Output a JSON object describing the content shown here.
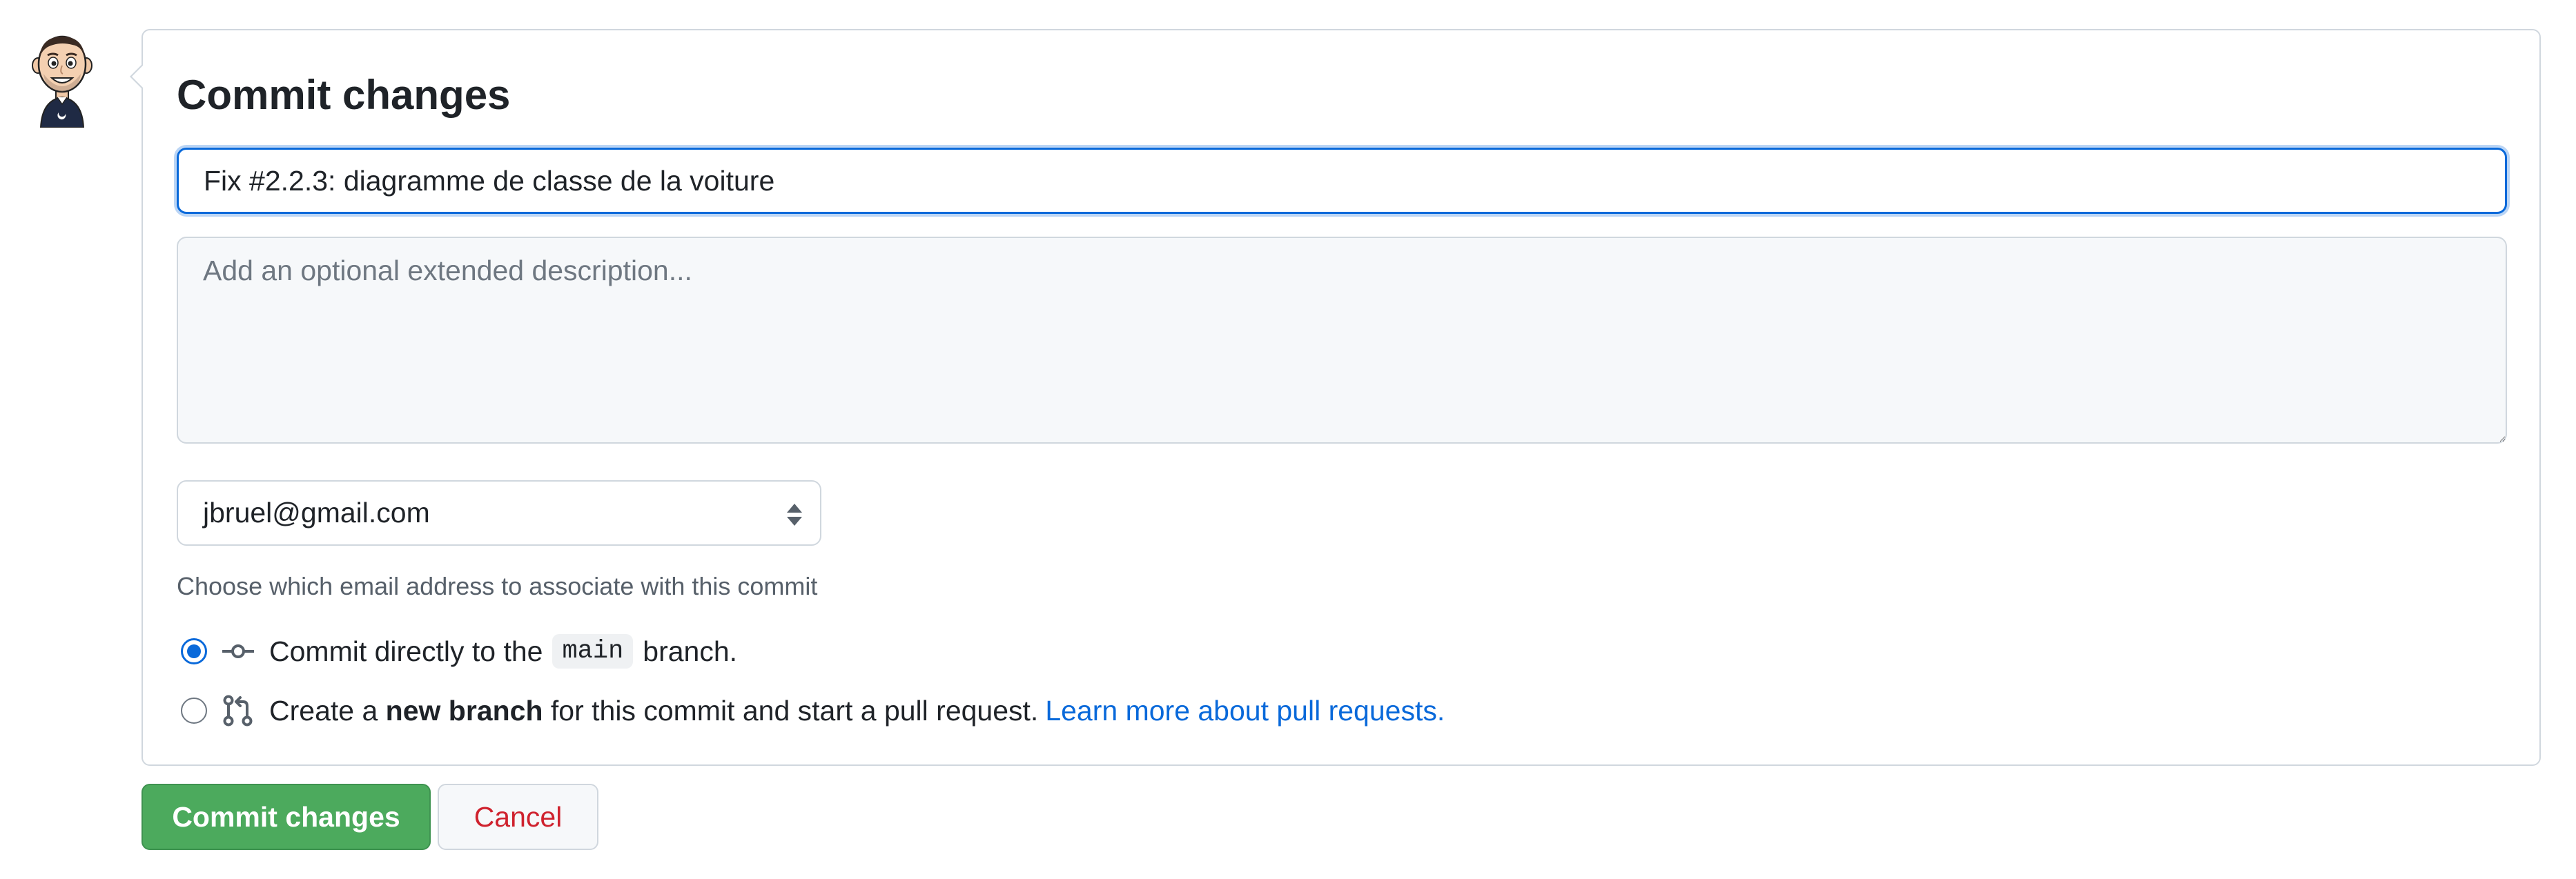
{
  "form": {
    "title": "Commit changes",
    "summary_value": "Fix #2.2.3: diagramme de classe de la voiture",
    "description_placeholder": "Add an optional extended description...",
    "email_selected": "jbruel@gmail.com",
    "email_hint": "Choose which email address to associate with this commit",
    "options": {
      "direct": {
        "before": "Commit directly to the",
        "branch": "main",
        "after": "branch.",
        "checked": true
      },
      "new_branch": {
        "before": "Create a",
        "bold": "new branch",
        "after": "for this commit and start a pull request.",
        "link": "Learn more about pull requests.",
        "checked": false
      }
    }
  },
  "buttons": {
    "commit": "Commit changes",
    "cancel": "Cancel"
  },
  "colors": {
    "accent": "#0969da",
    "commit_button": "#4caa5d",
    "cancel_text": "#cf222e",
    "link": "#0969da"
  },
  "icons": {
    "avatar": "user-avatar-icon",
    "commit": "git-commit-icon",
    "pull_request": "git-pull-request-icon",
    "select": "select-arrows-icon"
  }
}
